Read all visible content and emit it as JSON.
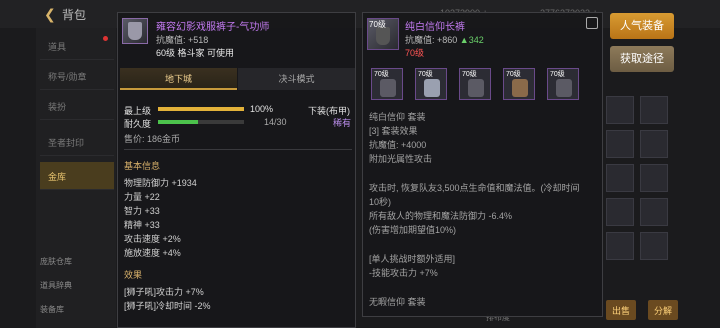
{
  "topbar": {
    "title": "背包",
    "currency_1": "10373900 +",
    "currency_2": "2776373023 +"
  },
  "sidebar": {
    "items": [
      {
        "label": "道具"
      },
      {
        "label": "称号/勋章"
      },
      {
        "label": "装扮"
      },
      {
        "label": "圣者封印"
      },
      {
        "label": "金库"
      }
    ],
    "bottom_1": "庞肤仓库",
    "bottom_2": "道具辞典",
    "bottom_3": "装备库"
  },
  "actions": {
    "hot_equip": "人气装备",
    "get_path": "获取途径",
    "sell": "出售",
    "decompose": "分解",
    "sort": "排布度"
  },
  "left_item": {
    "name": "雍容幻影戏服裤子-气功师",
    "stat": "抗魔值: +518",
    "level_line": "60级 格斗家 可使用",
    "tabs": [
      "地下城",
      "决斗模式"
    ],
    "max_level_label": "最上级",
    "max_level_value": "100%",
    "durability_label": "耐久度",
    "durability_value": "14/30",
    "max_level_progress": 1.0,
    "durability_progress": 0.4667,
    "slot_label": "下装(布甲)",
    "rarity": "稀有",
    "price": "售价: 186金币",
    "basic_title": "基本信息",
    "basic": [
      "物理防御力 +1934",
      "力量 +22",
      "智力 +33",
      "精神 +33",
      "攻击速度 +2%",
      "施放速度 +4%"
    ],
    "effect_title": "效果",
    "effects": [
      "[狮子吼]攻击力 +7%",
      "[狮子吼]冷却时间 -2%"
    ]
  },
  "right_item": {
    "icon_level": "70级",
    "name": "纯白信仰长裤",
    "stat_prefix": "抗魔值: +860",
    "stat_up": "▲342",
    "level_req": "70级",
    "set_slots": [
      "70级",
      "70级",
      "70级",
      "70级",
      "70级"
    ],
    "lines": [
      "纯白信仰 套装",
      "[3] 套装效果",
      "抗魔值: +4000",
      "附加光属性攻击",
      "",
      "攻击时, 恢复队友3,500点生命值和魔法值。(冷却时间",
      "10秒)",
      "所有敌人的物理和魔法防御力 -6.4%",
      "(伤害增加期望值10%)",
      "",
      "[单人挑战时额外适用]",
      "-技能攻击力 +7%",
      "",
      "无暇信仰 套装"
    ]
  },
  "colors": {
    "purple_name": "#c27af0",
    "gold": "#d8b46a",
    "green_up": "#6ad06a",
    "red_req": "#ff5555"
  }
}
